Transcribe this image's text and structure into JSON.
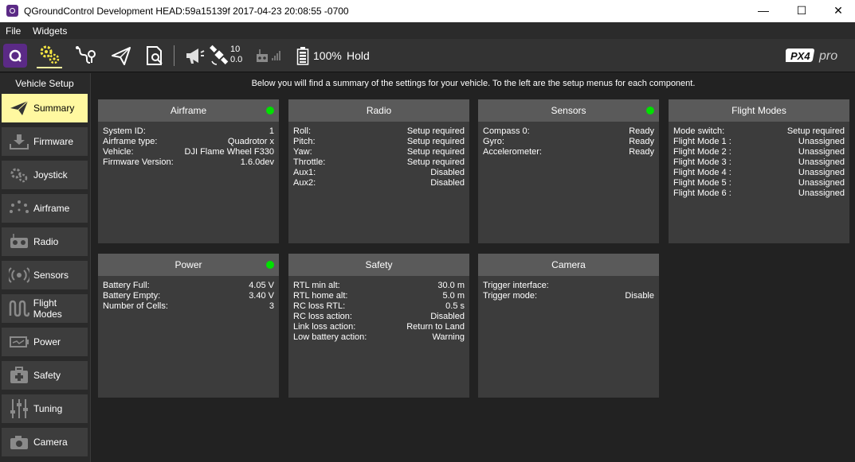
{
  "window": {
    "title": "QGroundControl Development HEAD:59a15139f 2017-04-23 20:08:55 -0700",
    "minimize": "—",
    "maximize": "☐",
    "close": "✕"
  },
  "menu": {
    "file": "File",
    "widgets": "Widgets"
  },
  "toolbar": {
    "gps_count": "10",
    "gps_hdop": "0.0",
    "battery": "100%",
    "flight_mode": "Hold",
    "brand": "PX4 pro"
  },
  "sidebar": {
    "title": "Vehicle Setup",
    "items": [
      {
        "label": "Summary",
        "icon": "plane-icon"
      },
      {
        "label": "Firmware",
        "icon": "download-icon"
      },
      {
        "label": "Joystick",
        "icon": "gears-icon"
      },
      {
        "label": "Airframe",
        "icon": "airframe-icon"
      },
      {
        "label": "Radio",
        "icon": "radio-icon"
      },
      {
        "label": "Sensors",
        "icon": "sensors-icon"
      },
      {
        "label": "Flight Modes",
        "icon": "wave-icon"
      },
      {
        "label": "Power",
        "icon": "power-icon"
      },
      {
        "label": "Safety",
        "icon": "medkit-icon"
      },
      {
        "label": "Tuning",
        "icon": "sliders-icon"
      },
      {
        "label": "Camera",
        "icon": "camera-icon"
      }
    ]
  },
  "intro": "Below you will find a summary of the settings for your vehicle. To the left are the setup menus for each component.",
  "cards": {
    "airframe": {
      "title": "Airframe",
      "rows": [
        [
          "System ID:",
          "1"
        ],
        [
          "Airframe type:",
          "Quadrotor x"
        ],
        [
          "Vehicle:",
          "DJI Flame Wheel F330"
        ],
        [
          "Firmware Version:",
          "1.6.0dev"
        ]
      ]
    },
    "radio": {
      "title": "Radio",
      "rows": [
        [
          "Roll:",
          "Setup required"
        ],
        [
          "Pitch:",
          "Setup required"
        ],
        [
          "Yaw:",
          "Setup required"
        ],
        [
          "Throttle:",
          "Setup required"
        ],
        [
          "Aux1:",
          "Disabled"
        ],
        [
          "Aux2:",
          "Disabled"
        ]
      ]
    },
    "sensors": {
      "title": "Sensors",
      "rows": [
        [
          "Compass 0:",
          "Ready"
        ],
        [
          "Gyro:",
          "Ready"
        ],
        [
          "Accelerometer:",
          "Ready"
        ]
      ]
    },
    "flight_modes": {
      "title": "Flight Modes",
      "rows": [
        [
          "Mode switch:",
          "Setup required"
        ],
        [
          "Flight Mode 1 :",
          "Unassigned"
        ],
        [
          "Flight Mode 2 :",
          "Unassigned"
        ],
        [
          "Flight Mode 3 :",
          "Unassigned"
        ],
        [
          "Flight Mode 4 :",
          "Unassigned"
        ],
        [
          "Flight Mode 5 :",
          "Unassigned"
        ],
        [
          "Flight Mode 6 :",
          "Unassigned"
        ]
      ]
    },
    "power": {
      "title": "Power",
      "rows": [
        [
          "Battery Full:",
          "4.05 V"
        ],
        [
          "Battery Empty:",
          "3.40 V"
        ],
        [
          "Number of Cells:",
          "3"
        ]
      ]
    },
    "safety": {
      "title": "Safety",
      "rows": [
        [
          "RTL min alt:",
          "30.0 m"
        ],
        [
          "RTL home alt:",
          "5.0 m"
        ],
        [
          "RC loss RTL:",
          "0.5 s"
        ],
        [
          "RC loss action:",
          "Disabled"
        ],
        [
          "Link loss action:",
          "Return to Land"
        ],
        [
          "Low battery action:",
          "Warning"
        ]
      ]
    },
    "camera": {
      "title": "Camera",
      "rows": [
        [
          "Trigger interface:",
          ""
        ],
        [
          "Trigger mode:",
          "Disable"
        ]
      ]
    }
  },
  "colors": {
    "active_item": "#fff8a0",
    "status_ok": "#00e000",
    "card_header": "#5a5a5a",
    "card_body": "#3c3c3c"
  }
}
